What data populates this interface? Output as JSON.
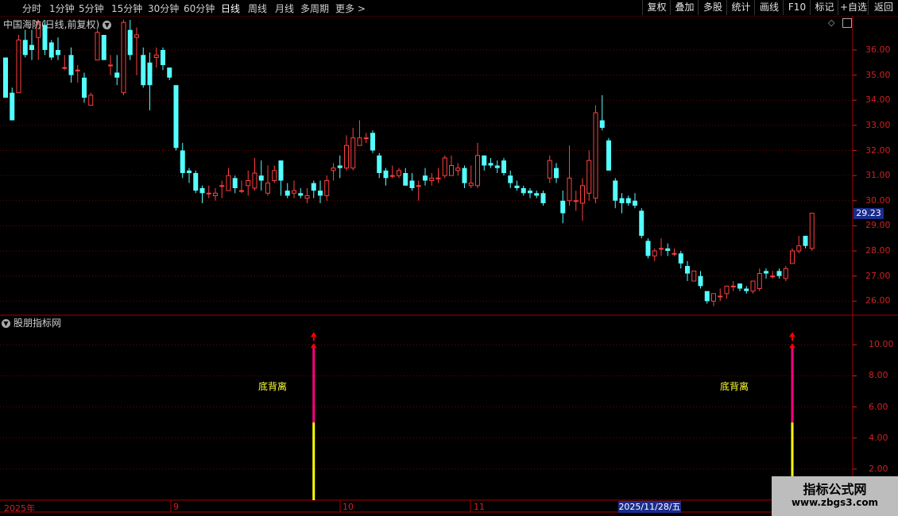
{
  "toolbar": {
    "tabs": [
      "分时",
      "1分钟",
      "5分钟",
      "15分钟",
      "30分钟",
      "60分钟",
      "日线",
      "周线",
      "月线",
      "多周期",
      "更多"
    ],
    "active_tab": "日线",
    "more_arrow": ">",
    "right_buttons": [
      "复权",
      "叠加",
      "多股",
      "统计",
      "画线",
      "F10",
      "标记",
      "+自选",
      "返回"
    ]
  },
  "main_panel": {
    "title": "中国海防(日线,前复权)",
    "dropdown_icon": "chevron-down-icon",
    "price_axis_ticks": [
      "36.00",
      "35.00",
      "34.00",
      "33.00",
      "32.00",
      "31.00",
      "30.00",
      "29.00",
      "28.00",
      "27.00",
      "26.00"
    ],
    "current_price": "29.23"
  },
  "indicator_panel": {
    "title": "股朋指标网",
    "axis_ticks": [
      "10.00",
      "8.00",
      "6.00",
      "4.00",
      "2.00"
    ],
    "signal_label": "底背离"
  },
  "date_axis": {
    "labels": [
      "2025年",
      "9",
      "10",
      "11"
    ],
    "cursor_date": "2025/11/28/五"
  },
  "watermark": {
    "line1": "指标公式网",
    "line2": "www.zbgs3.com"
  },
  "colors": {
    "up": "#ff4040",
    "down": "#54ffff",
    "grid": "#7a0000",
    "axis": "#cc2222",
    "highlight": "#1a2c8c",
    "signal_top": "#ff0080",
    "signal_bottom": "#ffff00",
    "arrow": "#ff0000"
  },
  "chart_data": {
    "type": "candlestick",
    "y_range": [
      25.6,
      37.2
    ],
    "indicator_y_range": [
      0,
      11.5
    ],
    "signal_values": [
      0,
      5,
      10
    ],
    "signal_bar_indices": [
      47,
      120
    ],
    "candles": [
      [
        35.7,
        34.1,
        35.7,
        34.1
      ],
      [
        34.3,
        33.2,
        34.5,
        33.2
      ],
      [
        34.3,
        36.4,
        36.6,
        34.3
      ],
      [
        36.4,
        35.8,
        36.8,
        35.7
      ],
      [
        36.2,
        36.0,
        36.8,
        35.6
      ],
      [
        36.5,
        37.1,
        37.2,
        35.6
      ],
      [
        37.0,
        36.0,
        37.2,
        35.8
      ],
      [
        36.3,
        35.7,
        36.4,
        35.6
      ],
      [
        36.0,
        35.8,
        36.5,
        35.6
      ],
      [
        35.3,
        35.3,
        35.8,
        35.2
      ],
      [
        35.8,
        35.0,
        36.1,
        34.7
      ],
      [
        35.2,
        35.2,
        35.4,
        34.7
      ],
      [
        34.9,
        34.1,
        35.1,
        33.9
      ],
      [
        33.8,
        34.2,
        34.3,
        33.8
      ],
      [
        35.6,
        36.7,
        36.8,
        35.6
      ],
      [
        36.6,
        35.6,
        36.6,
        35.6
      ],
      [
        35.4,
        35.4,
        35.8,
        35.0
      ],
      [
        35.1,
        34.9,
        35.8,
        34.6
      ],
      [
        34.3,
        37.1,
        37.2,
        34.2
      ],
      [
        36.8,
        35.8,
        37.2,
        35.6
      ],
      [
        36.5,
        36.6,
        36.9,
        35.0
      ],
      [
        35.8,
        34.6,
        36.1,
        34.5
      ],
      [
        35.5,
        34.6,
        35.9,
        33.6
      ],
      [
        35.7,
        35.8,
        36.1,
        35.3
      ],
      [
        36.0,
        35.4,
        36.1,
        35.2
      ],
      [
        35.3,
        34.9,
        35.3,
        34.8
      ],
      [
        34.6,
        32.1,
        34.6,
        32.0
      ],
      [
        32.0,
        31.1,
        32.3,
        30.9
      ],
      [
        31.2,
        31.1,
        31.3,
        30.7
      ],
      [
        31.1,
        30.4,
        31.2,
        30.3
      ],
      [
        30.5,
        30.3,
        30.6,
        29.9
      ],
      [
        30.3,
        30.3,
        30.6,
        30.1
      ],
      [
        30.2,
        30.3,
        30.5,
        30.0
      ],
      [
        30.6,
        30.6,
        30.8,
        30.1
      ],
      [
        30.4,
        31.0,
        31.3,
        30.4
      ],
      [
        30.9,
        30.5,
        31.0,
        30.3
      ],
      [
        30.4,
        30.4,
        30.8,
        30.3
      ],
      [
        30.6,
        30.8,
        31.2,
        30.2
      ],
      [
        30.5,
        31.1,
        31.7,
        30.4
      ],
      [
        31.0,
        30.8,
        31.6,
        30.4
      ],
      [
        30.3,
        30.7,
        31.4,
        30.2
      ],
      [
        30.8,
        31.2,
        31.4,
        30.7
      ],
      [
        31.6,
        30.8,
        31.6,
        30.2
      ],
      [
        30.4,
        30.2,
        30.7,
        30.1
      ],
      [
        30.3,
        30.4,
        30.8,
        30.1
      ],
      [
        30.3,
        30.2,
        30.5,
        30.1
      ],
      [
        30.1,
        30.2,
        30.5,
        29.9
      ],
      [
        30.7,
        30.4,
        30.8,
        30.1
      ],
      [
        30.4,
        30.2,
        30.8,
        29.9
      ],
      [
        30.2,
        30.8,
        31.0,
        30.0
      ],
      [
        31.2,
        31.3,
        31.5,
        30.8
      ],
      [
        31.4,
        31.3,
        31.8,
        30.9
      ],
      [
        31.3,
        32.2,
        32.6,
        31.2
      ],
      [
        31.3,
        32.5,
        32.9,
        31.2
      ],
      [
        32.2,
        32.5,
        33.2,
        32.2
      ],
      [
        32.5,
        32.5,
        32.7,
        32.3
      ],
      [
        32.7,
        32.0,
        32.8,
        31.9
      ],
      [
        31.8,
        31.1,
        31.9,
        30.9
      ],
      [
        31.2,
        30.9,
        31.3,
        30.6
      ],
      [
        31.0,
        31.0,
        31.4,
        30.9
      ],
      [
        31.0,
        31.2,
        31.3,
        30.9
      ],
      [
        31.1,
        30.6,
        31.3,
        30.6
      ],
      [
        30.8,
        30.5,
        31.1,
        30.4
      ],
      [
        30.6,
        30.6,
        30.8,
        30.0
      ],
      [
        31.0,
        30.8,
        31.3,
        30.6
      ],
      [
        30.8,
        30.9,
        31.1,
        30.6
      ],
      [
        30.9,
        30.9,
        31.3,
        30.7
      ],
      [
        31.0,
        31.7,
        31.8,
        30.9
      ],
      [
        31.0,
        31.4,
        31.8,
        31.0
      ],
      [
        31.2,
        31.3,
        31.5,
        31.0
      ],
      [
        31.3,
        30.7,
        31.4,
        30.5
      ],
      [
        30.6,
        30.7,
        31.4,
        30.5
      ],
      [
        30.6,
        31.8,
        32.3,
        30.5
      ],
      [
        31.8,
        31.4,
        31.8,
        31.2
      ],
      [
        31.5,
        31.4,
        31.7,
        31.3
      ],
      [
        31.4,
        31.3,
        31.6,
        31.1
      ],
      [
        31.6,
        31.1,
        31.7,
        31.0
      ],
      [
        31.0,
        30.7,
        31.2,
        30.5
      ],
      [
        30.6,
        30.5,
        30.8,
        30.4
      ],
      [
        30.5,
        30.3,
        30.6,
        30.2
      ],
      [
        30.4,
        30.3,
        30.5,
        30.1
      ],
      [
        30.3,
        30.2,
        30.4,
        30.1
      ],
      [
        30.3,
        29.9,
        30.4,
        29.8
      ],
      [
        30.9,
        31.6,
        31.8,
        30.7
      ],
      [
        31.3,
        30.9,
        31.5,
        30.7
      ],
      [
        30.0,
        29.5,
        30.4,
        29.1
      ],
      [
        30.0,
        30.9,
        32.2,
        29.8
      ],
      [
        30.0,
        30.0,
        30.4,
        29.6
      ],
      [
        29.9,
        30.6,
        30.9,
        29.2
      ],
      [
        30.3,
        31.6,
        32.0,
        30.0
      ],
      [
        30.1,
        33.5,
        33.8,
        29.9
      ],
      [
        33.2,
        32.9,
        34.2,
        32.8
      ],
      [
        32.4,
        31.2,
        32.5,
        31.2
      ],
      [
        30.8,
        30.0,
        30.9,
        29.7
      ],
      [
        30.1,
        29.9,
        30.3,
        29.5
      ],
      [
        30.1,
        29.9,
        30.2,
        29.8
      ],
      [
        30.0,
        29.8,
        30.3,
        29.7
      ],
      [
        29.6,
        28.6,
        29.7,
        28.5
      ],
      [
        28.4,
        27.8,
        28.5,
        27.7
      ],
      [
        27.8,
        28.0,
        28.1,
        27.6
      ],
      [
        28.1,
        28.1,
        28.5,
        27.8
      ],
      [
        28.1,
        28.0,
        28.3,
        27.8
      ],
      [
        27.9,
        27.9,
        28.1,
        27.8
      ],
      [
        27.9,
        27.5,
        28.0,
        27.3
      ],
      [
        27.4,
        27.1,
        27.6,
        26.8
      ],
      [
        26.8,
        27.2,
        27.2,
        26.8
      ],
      [
        27.0,
        26.6,
        27.2,
        26.5
      ],
      [
        26.4,
        26.0,
        26.4,
        25.9
      ],
      [
        26.0,
        26.3,
        26.3,
        25.8
      ],
      [
        26.2,
        26.2,
        26.5,
        26.0
      ],
      [
        26.3,
        26.6,
        26.6,
        26.1
      ],
      [
        26.6,
        26.6,
        26.8,
        26.4
      ],
      [
        26.7,
        26.5,
        26.7,
        26.4
      ],
      [
        26.5,
        26.4,
        26.6,
        26.3
      ],
      [
        26.4,
        26.8,
        26.8,
        26.3
      ],
      [
        26.5,
        27.1,
        27.3,
        26.4
      ],
      [
        27.2,
        27.1,
        27.3,
        26.9
      ],
      [
        27.0,
        27.0,
        27.2,
        26.9
      ],
      [
        27.2,
        27.0,
        27.3,
        26.9
      ],
      [
        26.9,
        27.3,
        27.4,
        26.8
      ],
      [
        27.5,
        28.0,
        28.1,
        27.5
      ],
      [
        28.0,
        28.2,
        28.6,
        27.9
      ],
      [
        28.6,
        28.2,
        28.6,
        28.1
      ],
      [
        28.1,
        29.5,
        29.5,
        28.0
      ]
    ]
  }
}
